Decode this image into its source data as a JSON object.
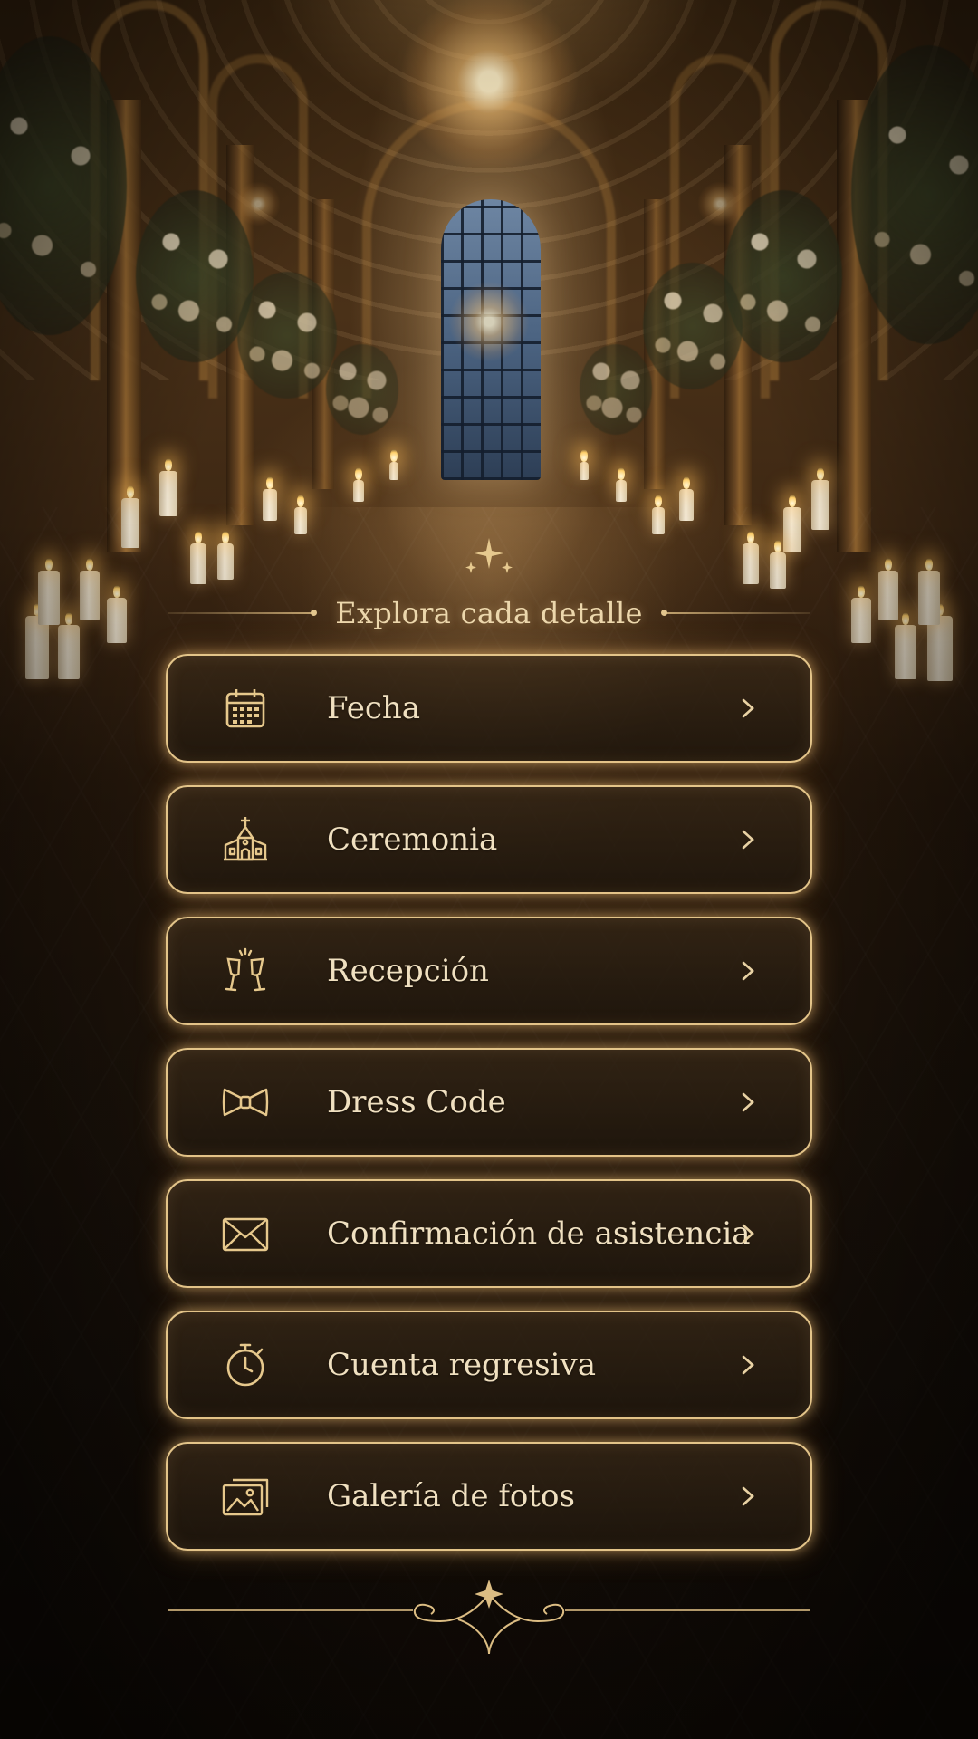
{
  "header": {
    "title": "Explora cada detalle"
  },
  "menu": {
    "items": [
      {
        "label": "Fecha",
        "icon": "calendar-icon"
      },
      {
        "label": "Ceremonia",
        "icon": "church-icon"
      },
      {
        "label": "Recepción",
        "icon": "champagne-glasses-icon"
      },
      {
        "label": "Dress Code",
        "icon": "bow-tie-icon"
      },
      {
        "label": "Confirmación de asistencia",
        "icon": "envelope-icon"
      },
      {
        "label": "Cuenta regresiva",
        "icon": "stopwatch-icon"
      },
      {
        "label": "Galería de fotos",
        "icon": "photo-gallery-icon"
      }
    ]
  },
  "colors": {
    "accent_gold": "#e3c489",
    "text_cream": "#f0e0c0",
    "button_fill": "#2a1e11"
  }
}
